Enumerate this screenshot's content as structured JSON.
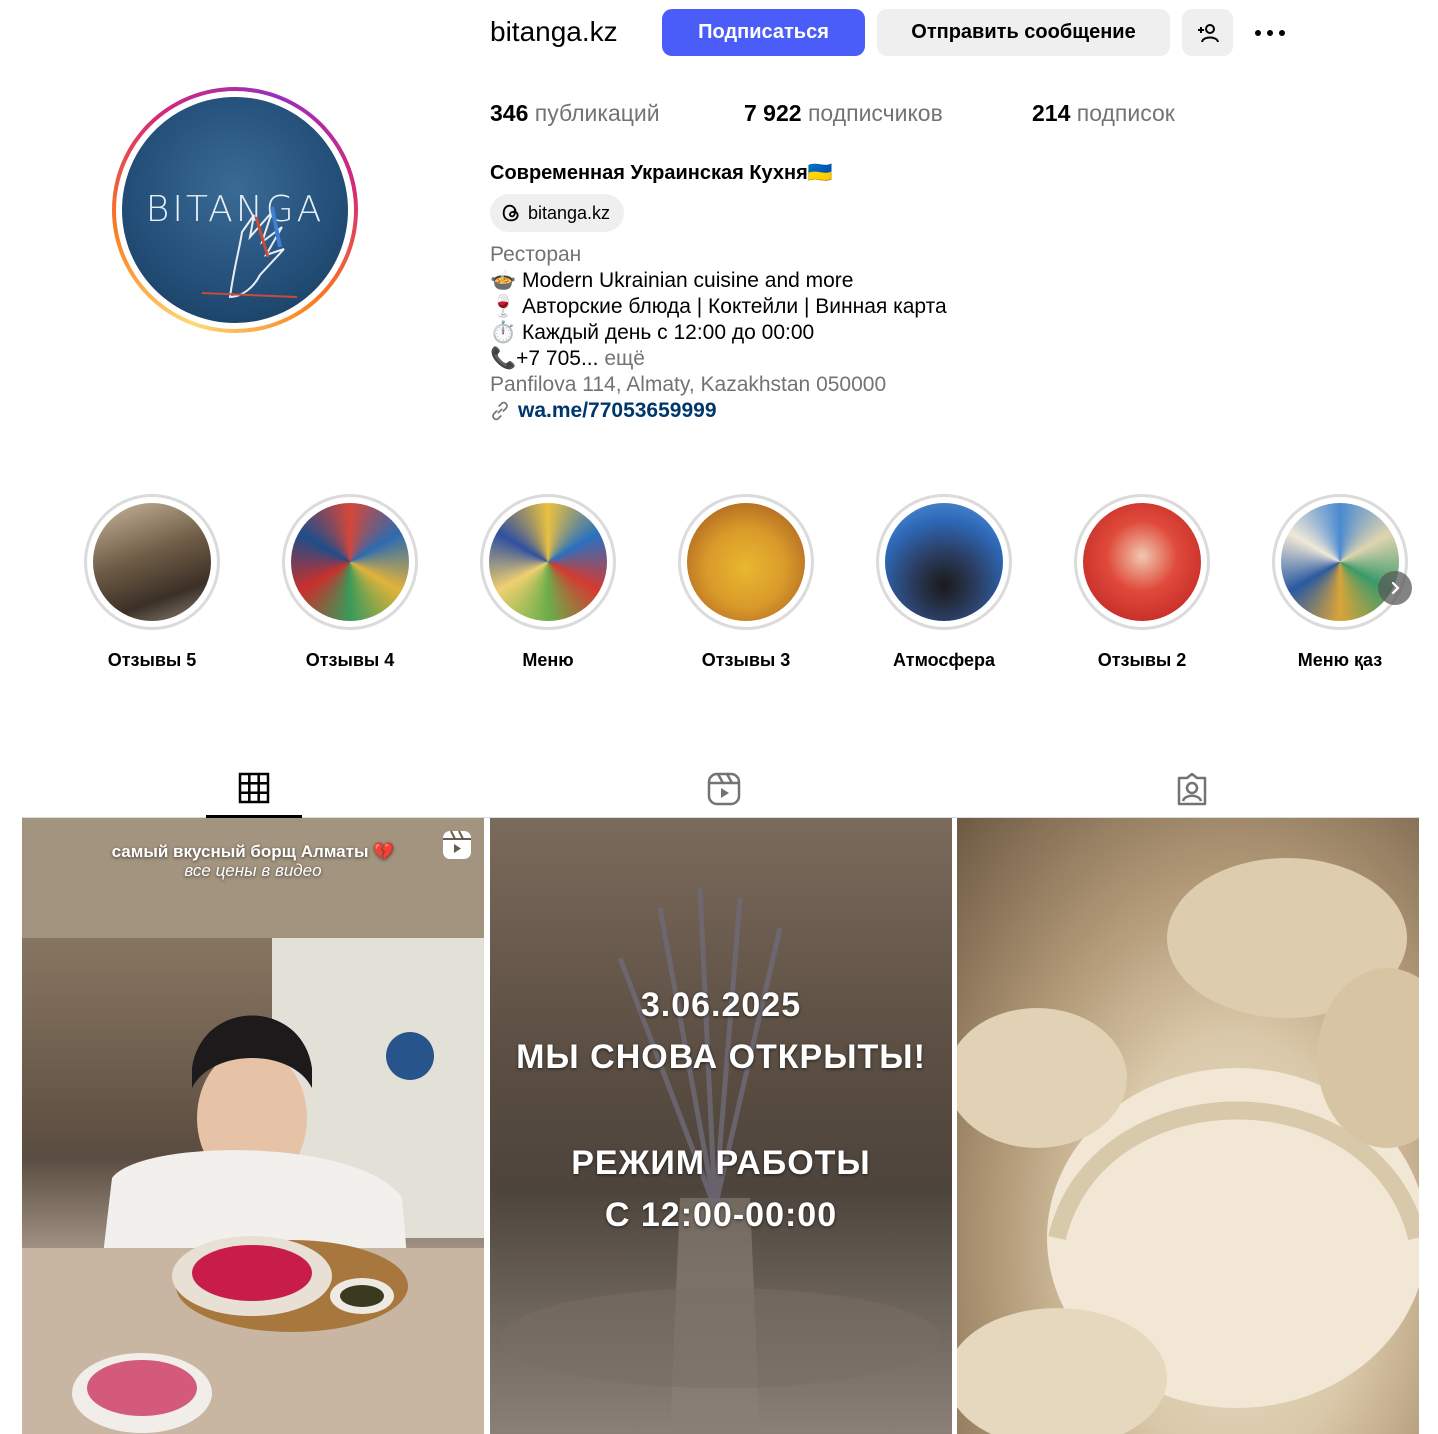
{
  "profile": {
    "username": "bitanga.kz",
    "avatar_text": "BITANGA",
    "follow_label": "Подписаться",
    "message_label": "Отправить сообщение",
    "add_user_icon": "add-person-icon",
    "more_icon": "more-dots-icon",
    "accent_color": "#4a5df9"
  },
  "stats": {
    "posts_count": "346",
    "posts_label": "публикаций",
    "followers_count": "7 922",
    "followers_label": "подписчиков",
    "following_count": "214",
    "following_label": "подписок"
  },
  "bio": {
    "full_name": "Современная Украинская Кухня🇺🇦",
    "threads_handle": "bitanga.kz",
    "category": "Ресторан",
    "line1": "🍲 Modern Ukrainian cuisine and more",
    "line2": "🍷 Авторские блюда | Коктейли | Винная карта",
    "line3": "⏱️ Каждый день с 12:00 до 00:00",
    "line4": "📞+7 705...",
    "more_label": "ещё",
    "address": "Panfilova 114, Almaty, Kazakhstan 050000",
    "link": "wa.me/77053659999",
    "link_color": "#00376b"
  },
  "highlights": [
    {
      "label": "Отзывы 5"
    },
    {
      "label": "Отзывы 4"
    },
    {
      "label": "Меню"
    },
    {
      "label": "Отзывы 3"
    },
    {
      "label": "Атмосфера"
    },
    {
      "label": "Отзывы 2"
    },
    {
      "label": "Меню қаз"
    }
  ],
  "tabs": [
    {
      "name": "posts",
      "icon": "grid-icon",
      "active": true
    },
    {
      "name": "reels",
      "icon": "reels-icon",
      "active": false
    },
    {
      "name": "tagged",
      "icon": "tagged-icon",
      "active": false
    }
  ],
  "posts": [
    {
      "caption_line1": "самый вкусный борщ Алматы 💔",
      "caption_line2": "все цены в видео",
      "type_icon": "reel-icon"
    },
    {
      "date": "3.06.2025",
      "headline": "МЫ СНОВА ОТКРЫТЫ!",
      "mode_label": "РЕЖИМ РАБОТЫ",
      "hours": "С 12:00-00:00"
    },
    {}
  ]
}
